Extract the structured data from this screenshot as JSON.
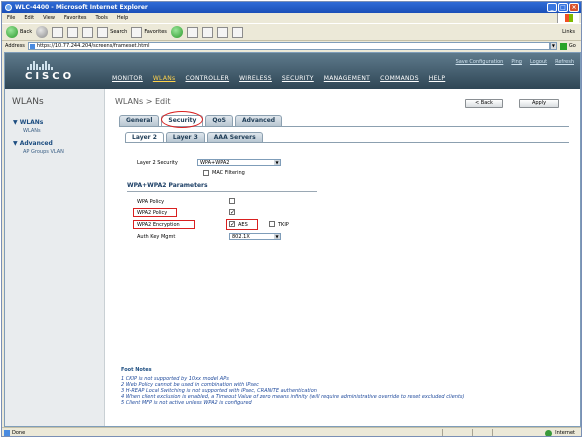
{
  "browser": {
    "title": "WLC-4400 - Microsoft Internet Explorer",
    "menu": [
      "File",
      "Edit",
      "View",
      "Favorites",
      "Tools",
      "Help"
    ],
    "toolbar": {
      "back": "Back",
      "search": "Search",
      "favorites": "Favorites",
      "links": "Links"
    },
    "address_label": "Address",
    "address_value": "https://10.77.244.204/screens/frameset.html",
    "go_label": "Go",
    "status": "Done",
    "zone": "Internet"
  },
  "cisco": {
    "logo_text": "CISCO",
    "top_links": [
      "Save Configuration",
      "Ping",
      "Logout",
      "Refresh"
    ],
    "nav": [
      "MONITOR",
      "WLANs",
      "CONTROLLER",
      "WIRELESS",
      "SECURITY",
      "MANAGEMENT",
      "COMMANDS",
      "HELP"
    ],
    "active_nav": "WLANs"
  },
  "leftnav": {
    "title": "WLANs",
    "groups": [
      {
        "label": "WLANs",
        "items": [
          "WLANs"
        ]
      },
      {
        "label": "Advanced",
        "items": [
          "AP Groups VLAN"
        ]
      }
    ]
  },
  "page": {
    "title": "WLANs > Edit",
    "back_button": "< Back",
    "apply_button": "Apply",
    "tabs": [
      "General",
      "Security",
      "QoS",
      "Advanced"
    ],
    "active_tab": "Security",
    "subtabs": [
      "Layer 2",
      "Layer 3",
      "AAA Servers"
    ],
    "active_subtab": "Layer 2",
    "layer2_security_label": "Layer 2 Security",
    "layer2_security_value": "WPA+WPA2",
    "mac_filtering_label": "MAC Filtering",
    "mac_filtering_checked": false,
    "params_title": "WPA+WPA2 Parameters",
    "wpa_policy_label": "WPA Policy",
    "wpa_policy_checked": false,
    "wpa2_policy_label": "WPA2 Policy",
    "wpa2_policy_checked": true,
    "wpa2_encryption_label": "WPA2 Encryption",
    "aes_label": "AES",
    "aes_checked": true,
    "tkip_label": "TKIP",
    "tkip_checked": false,
    "auth_key_label": "Auth Key Mgmt",
    "auth_key_value": "802.1X",
    "foot_title": "Foot Notes",
    "footnotes": [
      "1 CKIP is not supported by 10xx model APs",
      "2 Web Policy cannot be used in combination with IPsec",
      "3 H-REAP Local Switching is not supported with IPsec, CRANITE authentication",
      "4 When client exclusion is enabled, a Timeout Value of zero means infinity (will require administrative override to reset excluded clients)",
      "5 Client MFP is not active unless WPA2 is configured"
    ]
  },
  "colors": {
    "accent_red": "#d92020",
    "nav_active": "#ffd34d",
    "header": "#2f4655"
  }
}
